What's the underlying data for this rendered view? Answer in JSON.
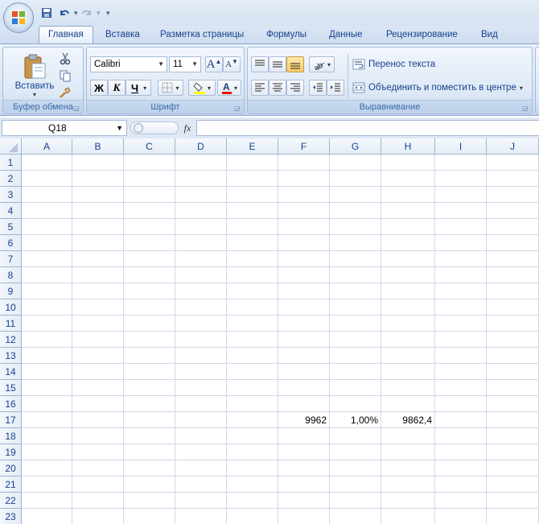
{
  "quick_access": {
    "customize_glyph": "▾"
  },
  "tabs": [
    "Главная",
    "Вставка",
    "Разметка страницы",
    "Формулы",
    "Данные",
    "Рецензирование",
    "Вид"
  ],
  "clipboard": {
    "paste_label": "Вставить",
    "group_label": "Буфер обмена"
  },
  "font": {
    "name": "Calibri",
    "size": "11",
    "bold": "Ж",
    "italic": "К",
    "underline": "Ч",
    "group_label": "Шрифт",
    "grow_label": "A",
    "shrink_label": "A"
  },
  "alignment": {
    "wrap_text": "Перенос текста",
    "merge_center": "Объединить и поместить в центре",
    "group_label": "Выравнивание"
  },
  "formula_bar": {
    "name_box": "Q18",
    "fx": "fx",
    "formula": ""
  },
  "columns": [
    "A",
    "B",
    "C",
    "D",
    "E",
    "F",
    "G",
    "H",
    "I",
    "J"
  ],
  "rows": [
    "1",
    "2",
    "3",
    "4",
    "5",
    "6",
    "7",
    "8",
    "9",
    "10",
    "11",
    "12",
    "13",
    "14",
    "15",
    "16",
    "17",
    "18",
    "19",
    "20",
    "21",
    "22",
    "23"
  ],
  "cells": {
    "F17": "9962",
    "G17": "1,00%",
    "H17": "9862,4"
  },
  "colors": {
    "accent": "#15428b",
    "ribbon": "#dce7f5",
    "highlight": "#f9c869",
    "fill_yellow": "#ffff00",
    "font_red": "#ff0000"
  }
}
